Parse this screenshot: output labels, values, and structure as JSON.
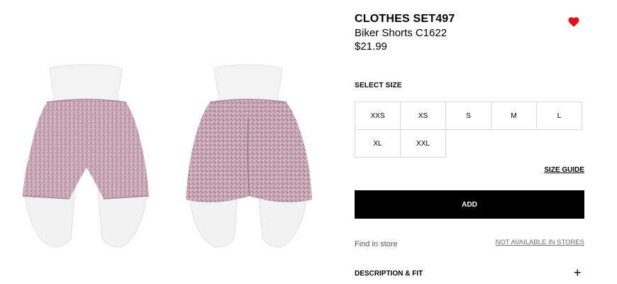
{
  "product": {
    "collection": "CLOTHES SET497",
    "name": "Biker Shorts C1622",
    "price": "$21.99"
  },
  "icons": {
    "wishlist": "heart-icon",
    "expand": "plus-icon"
  },
  "colors": {
    "wishlist": "#e0101c",
    "button_bg": "#000000",
    "fabric": "#c9a9b6"
  },
  "size": {
    "label": "SELECT SIZE",
    "options": [
      "XXS",
      "XS",
      "S",
      "M",
      "L",
      "XL",
      "XXL"
    ],
    "guide": "SIZE GUIDE"
  },
  "actions": {
    "add": "ADD"
  },
  "store": {
    "find": "Find in store",
    "availability": "NOT AVAILABLE IN STORES"
  },
  "description": {
    "label": "DESCRIPTION & FIT",
    "toggle": "+"
  }
}
